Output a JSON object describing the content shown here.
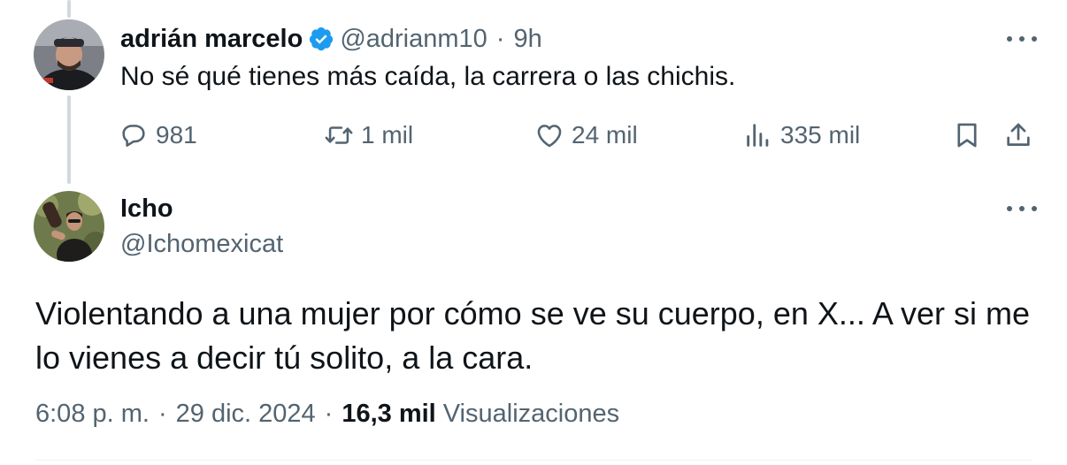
{
  "reply_tweet": {
    "display_name": "adrián marcelo",
    "handle": "@adrianm10",
    "separator": "·",
    "time": "9h",
    "text": "No sé qué tienes más caída, la carrera o las chichis.",
    "actions": {
      "replies": "981",
      "retweets": "1 mil",
      "likes": "24 mil",
      "views": "335 mil"
    },
    "verified": true,
    "verified_color": "#1d9bf0"
  },
  "main_tweet": {
    "display_name": "Icho",
    "handle": "@Ichomexicat",
    "text": "Violentando a una mujer por cómo se ve  su cuerpo, en X... A ver si me lo vienes a decir tú solito, a la cara.",
    "time": "6:08 p. m.",
    "separator": "·",
    "date": "29 dic. 2024",
    "views_count": "16,3 mil",
    "views_label": "Visualizaciones"
  },
  "colors": {
    "text_primary": "#0f1419",
    "text_secondary": "#536471",
    "thread_line": "#cfd9de"
  },
  "icons": [
    "verified-badge-icon",
    "more-icon",
    "reply-icon",
    "retweet-icon",
    "like-icon",
    "views-icon",
    "bookmark-icon",
    "share-icon"
  ]
}
